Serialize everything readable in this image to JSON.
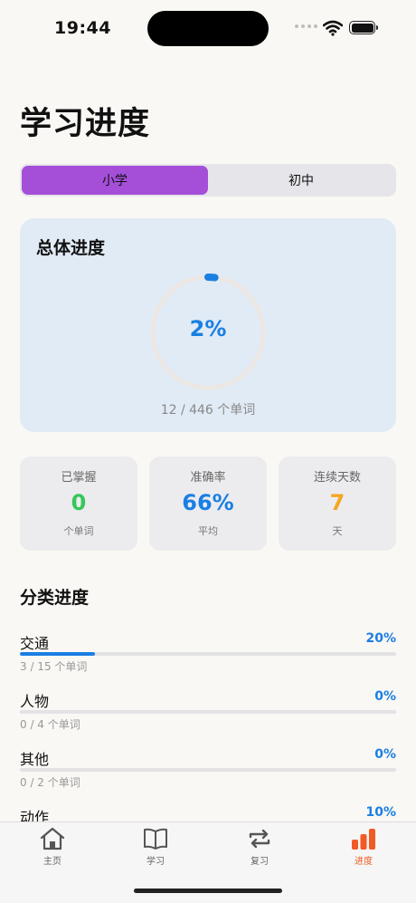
{
  "status_bar": {
    "time": "19:44"
  },
  "page": {
    "title": "学习进度"
  },
  "segments": [
    {
      "label": "小学",
      "active": true
    },
    {
      "label": "初中",
      "active": false
    }
  ],
  "overall": {
    "title": "总体进度",
    "percent_label": "2%",
    "percent": 0.02,
    "subtitle": "12 / 446 个单词"
  },
  "stats": [
    {
      "label": "已掌握",
      "value": "0",
      "unit": "个单词",
      "color": "#34c759"
    },
    {
      "label": "准确率",
      "value": "66%",
      "unit": "平均",
      "color": "#1a7fe3"
    },
    {
      "label": "连续天数",
      "value": "7",
      "unit": "天",
      "color": "#f5a623"
    }
  ],
  "categories_section": {
    "title": "分类进度",
    "items": [
      {
        "name": "交通",
        "percent_label": "20%",
        "percent": 0.2,
        "count": "3 / 15 个单词"
      },
      {
        "name": "人物",
        "percent_label": "0%",
        "percent": 0.0,
        "count": "0 / 4 个单词"
      },
      {
        "name": "其他",
        "percent_label": "0%",
        "percent": 0.0,
        "count": "0 / 2 个单词"
      },
      {
        "name": "动作",
        "percent_label": "10%",
        "percent": 0.1,
        "count": ""
      }
    ]
  },
  "tabs": [
    {
      "label": "主页",
      "icon": "house-icon",
      "active": false
    },
    {
      "label": "学习",
      "icon": "book-icon",
      "active": false
    },
    {
      "label": "复习",
      "icon": "repeat-icon",
      "active": false
    },
    {
      "label": "进度",
      "icon": "chart-bar-icon",
      "active": true
    }
  ],
  "colors": {
    "accent": "#1a7fe3",
    "segment_active": "#a54fd9",
    "tab_active": "#f15a24"
  }
}
